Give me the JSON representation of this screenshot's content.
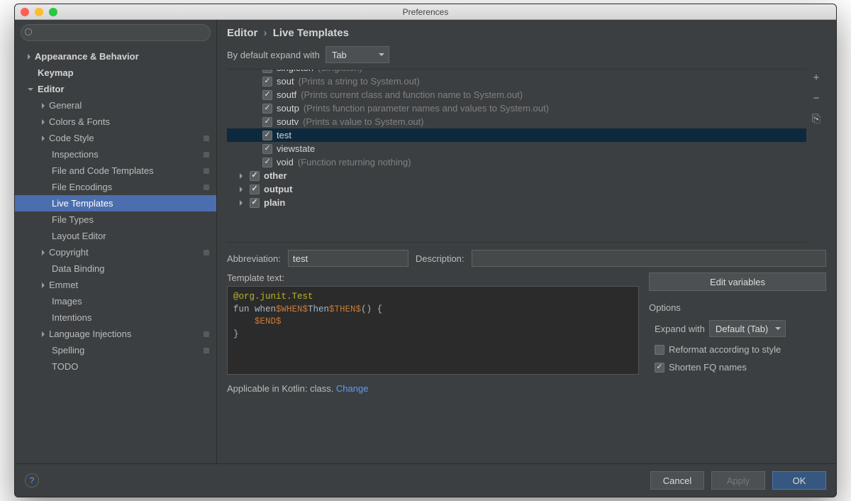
{
  "window": {
    "title": "Preferences"
  },
  "breadcrumb": {
    "root": "Editor",
    "leaf": "Live Templates"
  },
  "expand": {
    "label": "By default expand with",
    "value": "Tab"
  },
  "sidebar": {
    "items": [
      {
        "label": "Appearance & Behavior",
        "bold": true,
        "arrow": "right"
      },
      {
        "label": "Keymap",
        "bold": true,
        "arrow": "none"
      },
      {
        "label": "Editor",
        "bold": true,
        "arrow": "down"
      },
      {
        "label": "General",
        "level": 1,
        "arrow": "right"
      },
      {
        "label": "Colors & Fonts",
        "level": 1,
        "arrow": "right"
      },
      {
        "label": "Code Style",
        "level": 1,
        "arrow": "right",
        "mod": true
      },
      {
        "label": "Inspections",
        "level": 1,
        "arrow": "none",
        "mod": true
      },
      {
        "label": "File and Code Templates",
        "level": 1,
        "arrow": "none",
        "mod": true
      },
      {
        "label": "File Encodings",
        "level": 1,
        "arrow": "none",
        "mod": true
      },
      {
        "label": "Live Templates",
        "level": 1,
        "arrow": "none",
        "selected": true
      },
      {
        "label": "File Types",
        "level": 1,
        "arrow": "none"
      },
      {
        "label": "Layout Editor",
        "level": 1,
        "arrow": "none"
      },
      {
        "label": "Copyright",
        "level": 1,
        "arrow": "right",
        "mod": true
      },
      {
        "label": "Data Binding",
        "level": 1,
        "arrow": "none"
      },
      {
        "label": "Emmet",
        "level": 1,
        "arrow": "right"
      },
      {
        "label": "Images",
        "level": 1,
        "arrow": "none"
      },
      {
        "label": "Intentions",
        "level": 1,
        "arrow": "none"
      },
      {
        "label": "Language Injections",
        "level": 1,
        "arrow": "right",
        "mod": true
      },
      {
        "label": "Spelling",
        "level": 1,
        "arrow": "none",
        "mod": true
      },
      {
        "label": "TODO",
        "level": 1,
        "arrow": "none"
      }
    ]
  },
  "templates": {
    "rows": [
      {
        "abbr": "singleton",
        "desc": "(Singleton)",
        "checked": true,
        "cut": true
      },
      {
        "abbr": "sout",
        "desc": "(Prints a string to System.out)",
        "checked": true
      },
      {
        "abbr": "soutf",
        "desc": "(Prints current class and function name to System.out)",
        "checked": true
      },
      {
        "abbr": "soutp",
        "desc": "(Prints function parameter names and values to System.out)",
        "checked": true
      },
      {
        "abbr": "soutv",
        "desc": "(Prints a value to System.out)",
        "checked": true
      },
      {
        "abbr": "test",
        "desc": "",
        "checked": true,
        "selected": true
      },
      {
        "abbr": "viewstate",
        "desc": "",
        "checked": true
      },
      {
        "abbr": "void",
        "desc": "(Function returning nothing)",
        "checked": true
      }
    ],
    "groups": [
      {
        "label": "other",
        "checked": true
      },
      {
        "label": "output",
        "checked": true
      },
      {
        "label": "plain",
        "checked": true
      }
    ]
  },
  "side_buttons": {
    "add": "+",
    "remove": "−",
    "copy": "⎘"
  },
  "form": {
    "abbr_label": "Abbreviation:",
    "abbr_value": "test",
    "desc_label": "Description:",
    "desc_value": "",
    "template_label": "Template text:",
    "template_code": {
      "line1a": "@org.junit.Test",
      "line2a": "fun when",
      "line2b": "$WHEN$",
      "line2c": "Then",
      "line2d": "$THEN$",
      "line2e": "() {",
      "line3a": "    ",
      "line3b": "$END$",
      "line4": "}"
    },
    "edit_vars": "Edit variables",
    "options_label": "Options",
    "expand_with_label": "Expand with",
    "expand_with_value": "Default (Tab)",
    "reformat_label": "Reformat according to style",
    "reformat_checked": false,
    "shorten_label": "Shorten FQ names",
    "shorten_checked": true,
    "applicable_text": "Applicable in Kotlin: class. ",
    "change_link": "Change"
  },
  "footer": {
    "cancel": "Cancel",
    "apply": "Apply",
    "ok": "OK"
  }
}
